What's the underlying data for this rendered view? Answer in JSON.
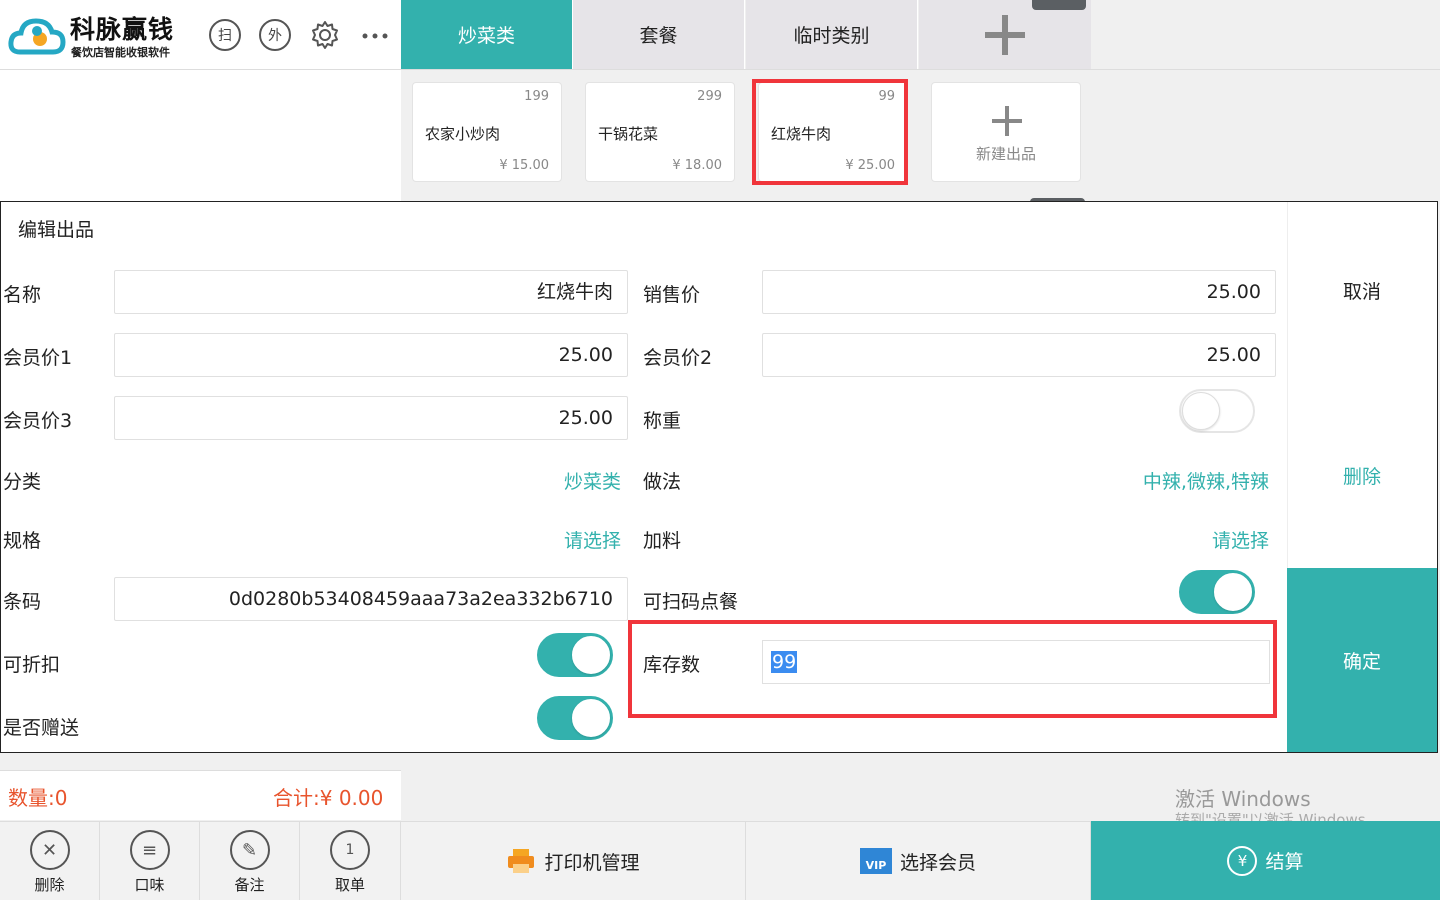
{
  "brand": {
    "title": "科脉赢钱",
    "subtitle": "餐饮店智能收银软件"
  },
  "header_icons": [
    {
      "name": "scan-icon",
      "glyph": "扫"
    },
    {
      "name": "takeout-icon",
      "glyph": "外"
    }
  ],
  "tabs": [
    {
      "label": "炒菜类",
      "active": true
    },
    {
      "label": "套餐",
      "active": false
    },
    {
      "label": "临时类别",
      "active": false
    }
  ],
  "products": [
    {
      "stock": "199",
      "name": "农家小炒肉",
      "price": "¥ 15.00"
    },
    {
      "stock": "299",
      "name": "干锅花菜",
      "price": "¥ 18.00"
    },
    {
      "stock": "99",
      "name": "红烧牛肉",
      "price": "¥ 25.00"
    }
  ],
  "new_product_label": "新建出品",
  "dialog": {
    "title": "编辑出品",
    "name_label": "名称",
    "name_value": "红烧牛肉",
    "sale_price_label": "销售价",
    "sale_price_value": "25.00",
    "member1_label": "会员价1",
    "member1_value": "25.00",
    "member2_label": "会员价2",
    "member2_value": "25.00",
    "member3_label": "会员价3",
    "member3_value": "25.00",
    "weigh_label": "称重",
    "weigh_on": false,
    "category_label": "分类",
    "category_value": "炒菜类",
    "method_label": "做法",
    "method_value": "中辣,微辣,特辣",
    "spec_label": "规格",
    "spec_value": "请选择",
    "addon_label": "加料",
    "addon_value": "请选择",
    "barcode_label": "条码",
    "barcode_value": "0d0280b53408459aaa73a2ea332b6710",
    "scan_order_label": "可扫码点餐",
    "scan_order_on": true,
    "discount_label": "可折扣",
    "discount_on": true,
    "stock_label": "库存数",
    "stock_value": "99",
    "gift_label": "是否赠送",
    "gift_on": true,
    "cancel": "取消",
    "delete": "删除",
    "confirm": "确定"
  },
  "summary": {
    "qty": "数量:0",
    "total": "合计:¥ 0.00"
  },
  "watermark": {
    "line1": "激活 Windows",
    "line2": "转到\"设置\"以激活 Windows。"
  },
  "bottom_buttons": [
    {
      "label": "删除",
      "icon": "delete-icon"
    },
    {
      "label": "口味",
      "icon": "flavor-icon"
    },
    {
      "label": "备注",
      "icon": "note-icon"
    },
    {
      "label": "取单",
      "icon": "retrieve-order-icon"
    }
  ],
  "printer_manage": "打印机管理",
  "select_member": "选择会员",
  "vip_badge": "VIP",
  "checkout": "结算",
  "colors": {
    "accent": "#33b1ad",
    "highlight": "#f0353b",
    "total": "#e8542d"
  }
}
